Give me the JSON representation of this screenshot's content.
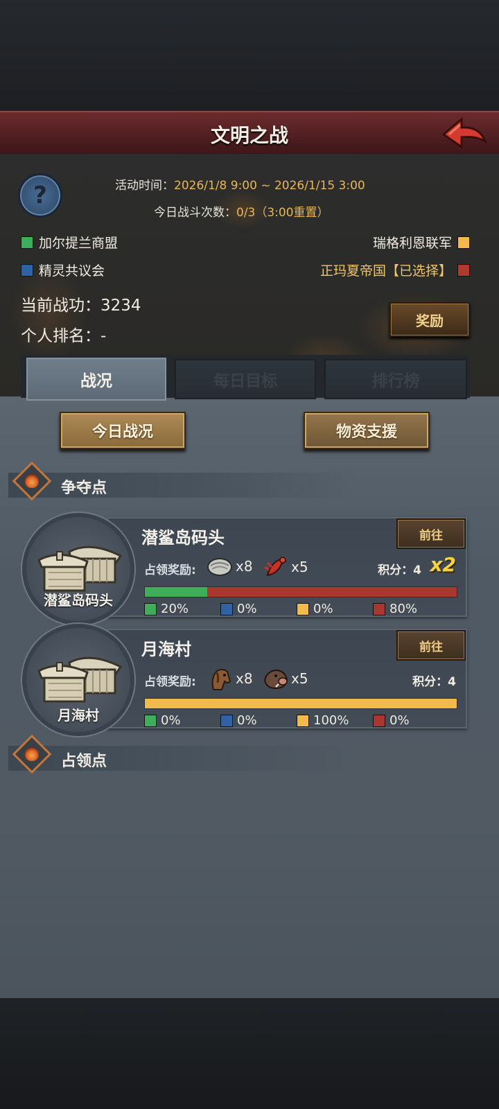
{
  "header": {
    "title": "文明之战"
  },
  "info": {
    "time_label": "活动时间：",
    "time_value": "2026/1/8 9:00 ~ 2026/1/15 3:00",
    "battle_label": "今日战斗次数：",
    "battle_value": "0/3（3:00重置）"
  },
  "factions": [
    {
      "name": "加尔提兰商盟",
      "color": "#3fae5a"
    },
    {
      "name": "精灵共议会",
      "color": "#2f62a4"
    },
    {
      "name": "瑞格利恩联军",
      "color": "#f2b94c"
    },
    {
      "name": "正玛夏帝国【已选择】",
      "color": "#b03a30"
    }
  ],
  "stats": {
    "merit": "当前战功：3234",
    "rank": "个人排名：-"
  },
  "reward_button": "奖励",
  "tabs": [
    {
      "label": "战况",
      "active": true
    },
    {
      "label": "每日目标",
      "active": false
    },
    {
      "label": "排行榜",
      "active": false
    }
  ],
  "buttons": {
    "today": "今日战况",
    "support": "物资支援"
  },
  "sections": {
    "contested": "争夺点",
    "occupied": "占领点"
  },
  "locations": [
    {
      "name": "潜鲨岛码头",
      "go": "前往",
      "reward_label": "占领奖励:",
      "rewards": [
        {
          "icon": "oyster-icon",
          "count": "x8"
        },
        {
          "icon": "lobster-icon",
          "count": "x5"
        }
      ],
      "score": "积分：4",
      "multiplier": "x2",
      "shares": [
        20,
        0,
        0,
        80
      ],
      "share_labels": [
        "20%",
        "0%",
        "0%",
        "80%"
      ]
    },
    {
      "name": "月海村",
      "go": "前往",
      "reward_label": "占领奖励:",
      "rewards": [
        {
          "icon": "horse-head-icon",
          "count": "x8"
        },
        {
          "icon": "boar-head-icon",
          "count": "x5"
        }
      ],
      "score": "积分：4",
      "shares": [
        0,
        0,
        100,
        0
      ],
      "share_labels": [
        "0%",
        "0%",
        "100%",
        "0%"
      ]
    }
  ]
}
